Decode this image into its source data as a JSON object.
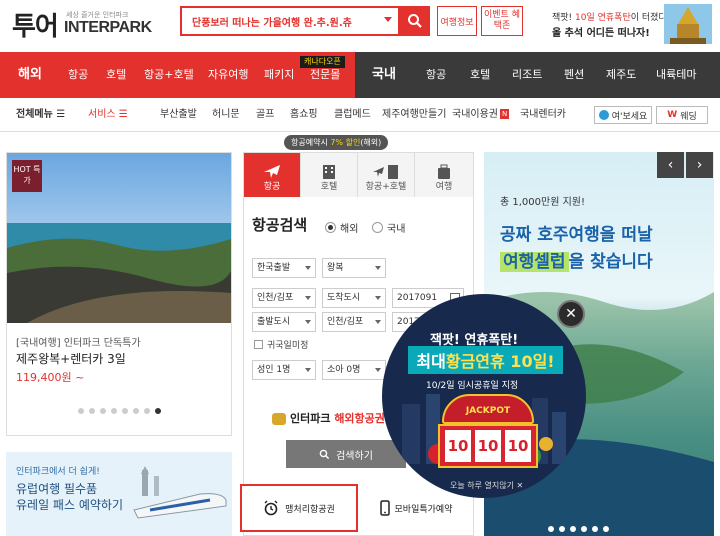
{
  "header": {
    "logo_ko": "투어",
    "logo_sub": "세상 즐거운 인터파크",
    "logo_en": "INTERPARK",
    "search_text": "단풍보러 떠나는 가을여행 완.추.원.츄",
    "btn_info": "여행정보",
    "btn_event": "이벤트 혜택존",
    "promo_pre": "잭팟! ",
    "promo_hl": "10일 연휴폭탄",
    "promo_post": "이 터졌다!",
    "promo_line2": "올 추석 어디든 떠나자!"
  },
  "nav": {
    "overseas": "해외",
    "overseas_items": [
      "항공",
      "호텔",
      "항공+호텔",
      "자유여행",
      "패키지",
      "전문몰"
    ],
    "new_badge": "캐나다오픈",
    "domestic": "국내",
    "domestic_items": [
      "항공",
      "호텔",
      "리조트",
      "펜션",
      "제주도",
      "내륙테마"
    ]
  },
  "subnav": {
    "all_menu": "전체메뉴 ☰",
    "service": "서비스 ☰",
    "items": [
      "부산출발",
      "허니문",
      "골프",
      "홈쇼핑",
      "클럽메드",
      "제주여행만들기",
      "국내이용권",
      "국내렌터카"
    ],
    "n_badge": "N",
    "btn_yes": "여'보세요",
    "btn_wed": "웨딩"
  },
  "card1": {
    "badge": "HOT 특가",
    "category": "[국내여행] 인터파크 단독특가",
    "title": "제주왕복+렌터카 3일",
    "price": "119,400원 ~"
  },
  "card2": {
    "line1": "인터파크에서 더 쉽게!",
    "line2": "유럽여행 필수품",
    "line3": "유레일 패스 예약하기"
  },
  "flight": {
    "notice_pre": "항공예약시 ",
    "notice_hl": "7% 할인",
    "notice_post": "(해외)",
    "tabs": [
      "항공",
      "호텔",
      "항공+호텔",
      "여행"
    ],
    "title": "항공검색",
    "radio_overseas": "해외",
    "radio_domestic": "국내",
    "sel_depart": "한국출발",
    "sel_trip": "왕복",
    "sel_from": "인천/김포",
    "sel_to": "도착도시",
    "date1": "2017091",
    "sel_from2": "출발도시",
    "sel_to2": "인천/김포",
    "date2": "2017091",
    "check_label": "귀국일미정",
    "sel_adult": "성인 1명",
    "sel_child": "소아 0명",
    "ip_pre": "인터파크 ",
    "ip_hl": "해외항공권",
    "search_btn": "검색하기",
    "lounge_btn": "맹처리항공권",
    "mobile_btn": "모바일특가예약"
  },
  "banner": {
    "small": "총 1,000만원 지원!",
    "line1": "공짜 호주여행을 떠날",
    "line2_hl": "여행셀럽",
    "line2_post": "을 찾습니다"
  },
  "popup": {
    "line1": "잭팟! 연휴폭탄!",
    "line2_pre": "최대 ",
    "line2_hl": "황금연휴 10일!",
    "line3": "10/2일 임시공휴일 지정",
    "jackpot": "JACKPOT",
    "reels": [
      "10",
      "10",
      "10"
    ],
    "footer": "오늘 하루 열지않기 ✕"
  }
}
